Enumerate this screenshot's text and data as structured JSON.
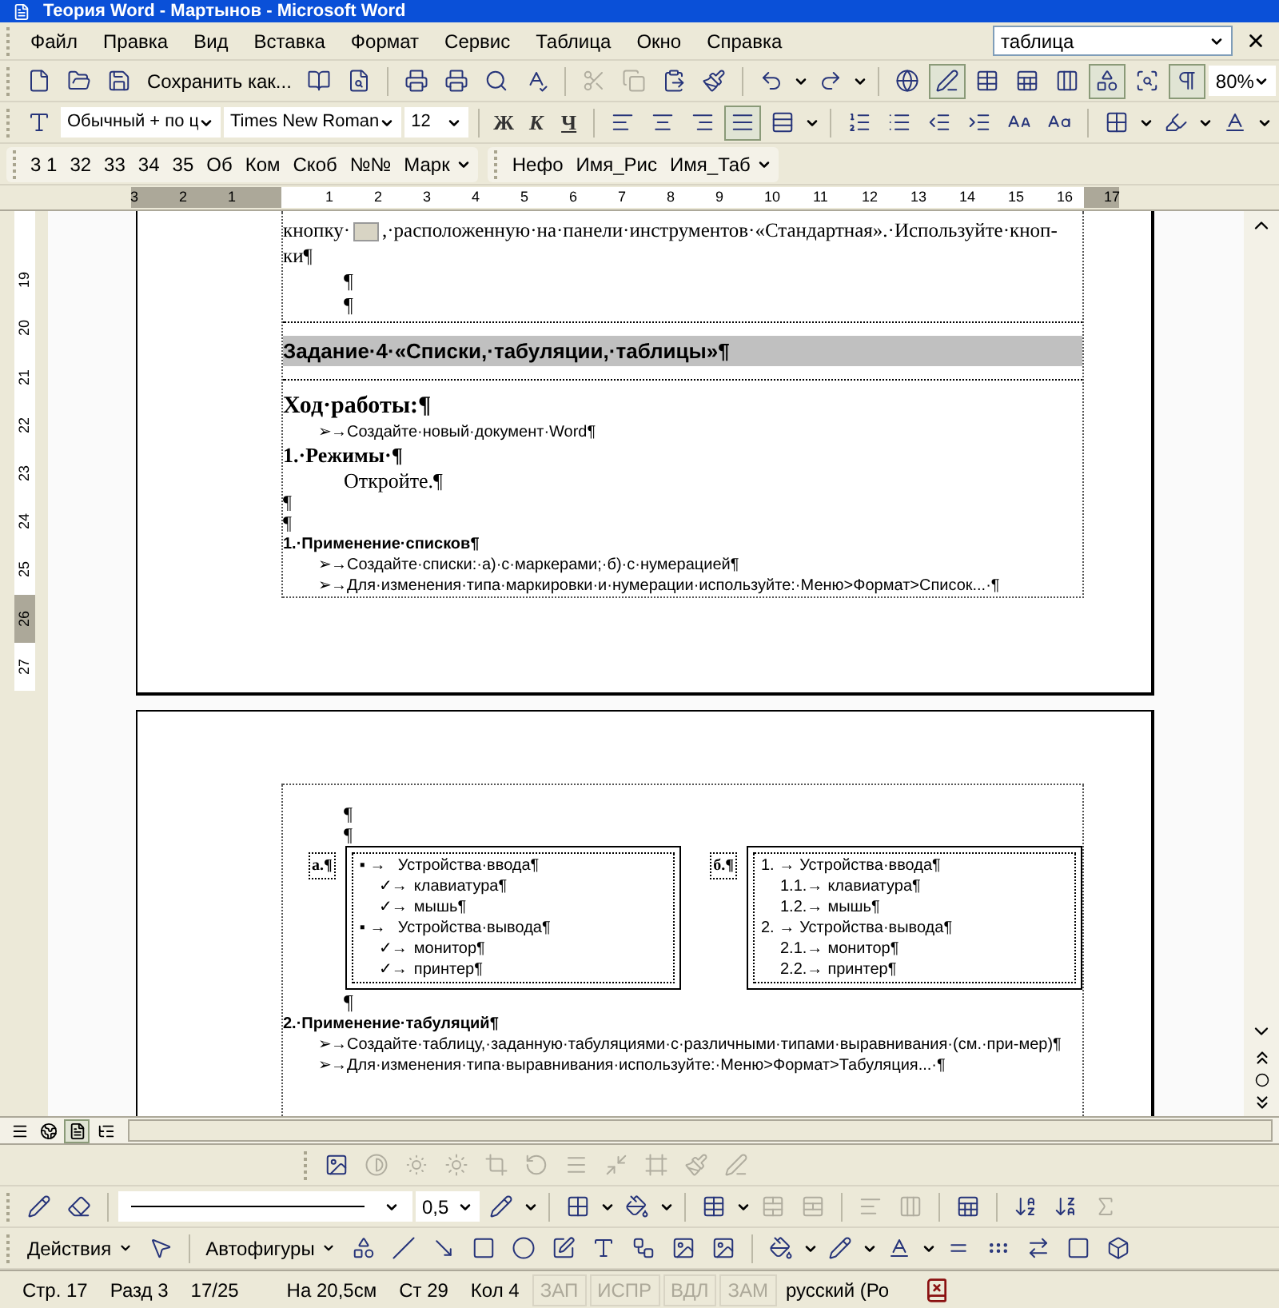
{
  "window": {
    "title": "Теория Word - Мартынов - Microsoft Word"
  },
  "menu": {
    "items": [
      "Файл",
      "Правка",
      "Вид",
      "Вставка",
      "Формат",
      "Сервис",
      "Таблица",
      "Окно",
      "Справка"
    ]
  },
  "help_search": {
    "value": "таблица"
  },
  "standard_toolbar": {
    "save_as_label": "Сохранить как...",
    "edit_enabled": false,
    "tables_and_borders_on": true,
    "drawing_on": true,
    "formatting_marks_on": true,
    "zoom": "80%"
  },
  "formatting_toolbar": {
    "style": "Обычный + по ц",
    "font": "Times New Roman",
    "size": "12",
    "bold": "Ж",
    "italic": "К",
    "underline": "Ч",
    "justify_on": true
  },
  "styles_toolbar": {
    "groups": [
      {
        "buttons": [
          "3 1",
          "32",
          "33",
          "34",
          "35",
          "Об",
          "Ком",
          "Скоб",
          "№№",
          "Марк"
        ]
      },
      {
        "buttons": [
          "Нефо",
          "Имя_Рис",
          "Имя_Таб"
        ]
      }
    ]
  },
  "ruler": {
    "left_labels": [
      "3",
      "2",
      "1"
    ],
    "labels": [
      "1",
      "2",
      "3",
      "4",
      "5",
      "6",
      "7",
      "8",
      "9",
      "10",
      "11",
      "12",
      "13",
      "14",
      "15",
      "16"
    ],
    "right_labels": [
      "17"
    ]
  },
  "vertical_ruler": {
    "labels": [
      {
        "text": "19",
        "selected": false
      },
      {
        "text": "20",
        "selected": false
      },
      {
        "text": "21",
        "selected": false
      },
      {
        "text": "22",
        "selected": false
      },
      {
        "text": "23",
        "selected": false
      },
      {
        "text": "24",
        "selected": false
      },
      {
        "text": "25",
        "selected": false
      },
      {
        "text": "26",
        "selected": true
      },
      {
        "text": "27",
        "selected": false
      }
    ]
  },
  "page_1": {
    "paragraphs": [
      {
        "kind": "icon_text",
        "before": "кнопку·",
        "after": ",·расположенную·на·панели·инструментов·«Стандартная».·Используйте·кноп-ки¶"
      },
      {
        "kind": "indent",
        "text": "¶"
      },
      {
        "kind": "indent",
        "text": "¶"
      },
      {
        "kind": "banner",
        "text": "Задание·4·«Списки,·табуляции,·таблицы»¶"
      },
      {
        "kind": "title",
        "text": "Ход·работы:¶"
      },
      {
        "kind": "bullet",
        "marker": "➢→",
        "text": "Создайте·новый·документ·Word¶"
      },
      {
        "kind": "bold",
        "text": "1.·Режимы·¶"
      },
      {
        "kind": "indent",
        "text": "Откройте.¶"
      },
      {
        "kind": "plain",
        "text": "¶"
      },
      {
        "kind": "plain",
        "text": "¶"
      },
      {
        "kind": "section",
        "text": "1.·Применение·списков¶"
      },
      {
        "kind": "bullet",
        "marker": "➢→",
        "text": "Создайте·списки:·а)·с·маркерами;·б)·с·нумерацией¶"
      },
      {
        "kind": "bullet",
        "marker": "➢→",
        "text": "Для·изменения·типа·маркировки·и·нумерации·используйте:·Меню>Формат>Список...·¶"
      }
    ]
  },
  "page_2": {
    "marks": [
      "¶",
      "¶"
    ],
    "lists": [
      {
        "label": "а.¶",
        "items": [
          {
            "marker": "▪ →",
            "text": "Устройства·ввода¶",
            "children": [
              {
                "marker": "✓→",
                "text": "клавиатура¶"
              },
              {
                "marker": "✓→",
                "text": "мышь¶"
              }
            ]
          },
          {
            "marker": "▪ →",
            "text": "Устройства·вывода¶",
            "children": [
              {
                "marker": "✓→",
                "text": "монитор¶"
              },
              {
                "marker": "✓→",
                "text": "принтер¶"
              }
            ]
          }
        ]
      },
      {
        "label": "б.¶",
        "items": [
          {
            "marker": "1. →",
            "text": "Устройства·ввода¶",
            "children": [
              {
                "marker": "1.1.→",
                "text": "клавиатура¶"
              },
              {
                "marker": "1.2.→",
                "text": "мышь¶"
              }
            ]
          },
          {
            "marker": "2. →",
            "text": "Устройства·вывода¶",
            "children": [
              {
                "marker": "2.1.→",
                "text": "монитор¶"
              },
              {
                "marker": "2.2.→",
                "text": "принтер¶"
              }
            ]
          }
        ]
      }
    ],
    "paragraphs": [
      {
        "kind": "indent",
        "text": "¶"
      },
      {
        "kind": "section",
        "text": "2.·Применение·табуляций¶"
      },
      {
        "kind": "bullet",
        "marker": "➢→",
        "text": "Создайте·таблицу,·заданную·табуляциями·с·различными·типами·выравнивания·(см.·при-мер)¶"
      },
      {
        "kind": "bullet",
        "marker": "➢→",
        "text": "Для·изменения·типа·выравнивания·используйте:·Меню>Формат>Табуляция...·¶"
      }
    ]
  },
  "views": [
    {
      "kind": "normal",
      "selected": false
    },
    {
      "kind": "web",
      "selected": false
    },
    {
      "kind": "print",
      "selected": true
    },
    {
      "kind": "outline",
      "selected": false
    }
  ],
  "picture_toolbar": {
    "adjust_enabled": false
  },
  "tables_toolbar": {
    "line_weight": "0,5",
    "cell_tools_enabled": false
  },
  "drawing_toolbar": {
    "actions": "Действия",
    "autoshapes": "Автофигуры"
  },
  "status_bar": {
    "fields": [
      "Стр. 17",
      "Разд 3",
      "17/25",
      "На 20,5см",
      "Ст 29",
      "Кол 4"
    ],
    "modes": [
      {
        "label": "ЗАП",
        "on": false
      },
      {
        "label": "ИСПР",
        "on": false
      },
      {
        "label": "ВДЛ",
        "on": false
      },
      {
        "label": "ЗАМ",
        "on": false
      }
    ],
    "language": "русский (Ро"
  }
}
